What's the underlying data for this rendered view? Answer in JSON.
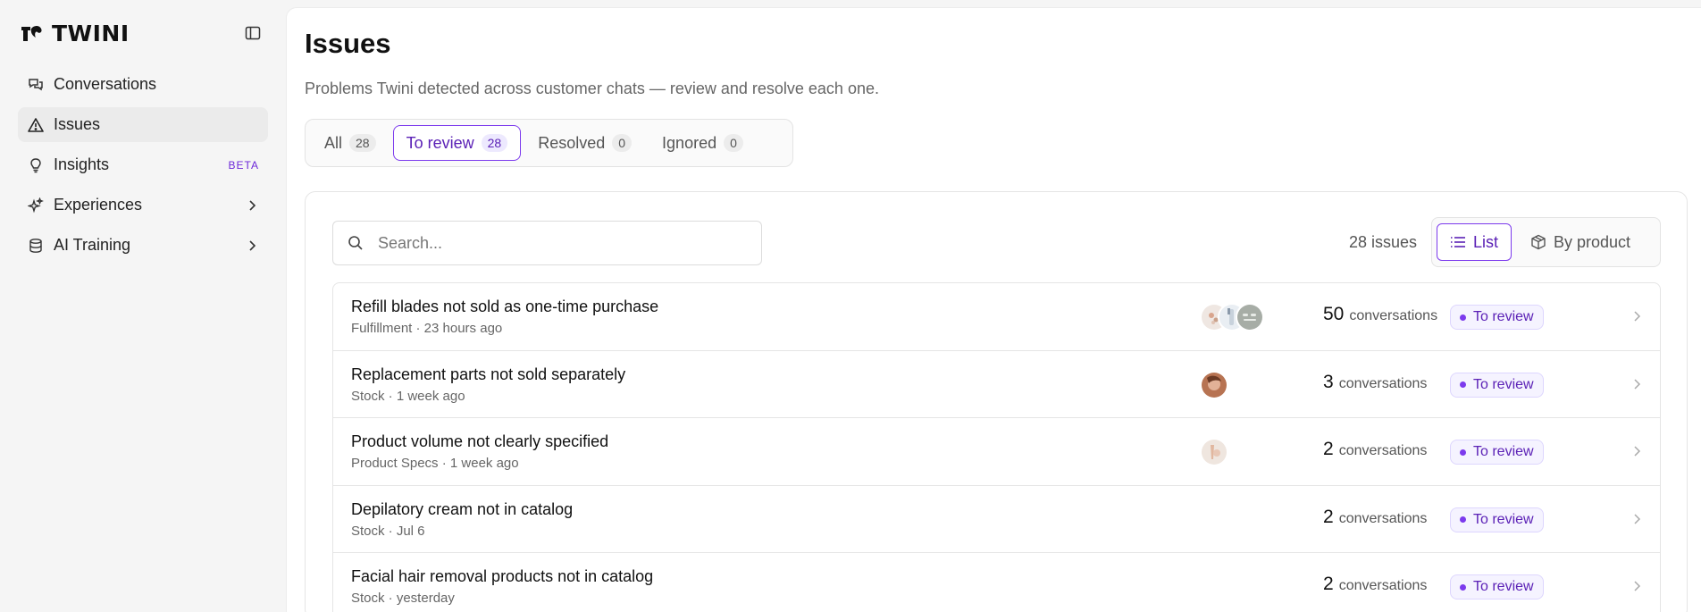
{
  "brand": {
    "name": "TWINI"
  },
  "sidebar": {
    "items": [
      {
        "label": "Conversations",
        "icon": "conversations-icon"
      },
      {
        "label": "Issues",
        "icon": "warning-triangle-icon",
        "active": true
      },
      {
        "label": "Insights",
        "icon": "lightbulb-icon",
        "badge": "BETA"
      },
      {
        "label": "Experiences",
        "icon": "sparkles-icon",
        "expandable": true
      },
      {
        "label": "AI Training",
        "icon": "database-icon",
        "expandable": true
      }
    ]
  },
  "page": {
    "title": "Issues",
    "subtitle": "Problems Twini detected across customer chats — review and resolve each one."
  },
  "tabs": [
    {
      "label": "All",
      "count": "28"
    },
    {
      "label": "To review",
      "count": "28",
      "active": true
    },
    {
      "label": "Resolved",
      "count": "0"
    },
    {
      "label": "Ignored",
      "count": "0"
    }
  ],
  "toolbar": {
    "search_placeholder": "Search...",
    "issue_count": "28 issues",
    "view_list": "List",
    "view_by_product": "By product"
  },
  "issues": [
    {
      "title": "Refill blades not sold as one-time purchase",
      "meta": "Fulfillment · 23 hours ago",
      "count": "50",
      "count_label": "conversations",
      "status": "To review",
      "avatars": 3
    },
    {
      "title": "Replacement parts not sold separately",
      "meta": "Stock · 1 week ago",
      "count": "3",
      "count_label": "conversations",
      "status": "To review",
      "avatars": 1
    },
    {
      "title": "Product volume not clearly specified",
      "meta": "Product Specs · 1 week ago",
      "count": "2",
      "count_label": "conversations",
      "status": "To review",
      "avatars": 1
    },
    {
      "title": "Depilatory cream not in catalog",
      "meta": "Stock · Jul 6",
      "count": "2",
      "count_label": "conversations",
      "status": "To review",
      "avatars": 0
    },
    {
      "title": "Facial hair removal products not in catalog",
      "meta": "Stock · yesterday",
      "count": "2",
      "count_label": "conversations",
      "status": "To review",
      "avatars": 0
    }
  ],
  "colors": {
    "accent": "#7c3aed",
    "accent_text": "#5b21b6",
    "badge_bg": "#f5f3ff"
  }
}
